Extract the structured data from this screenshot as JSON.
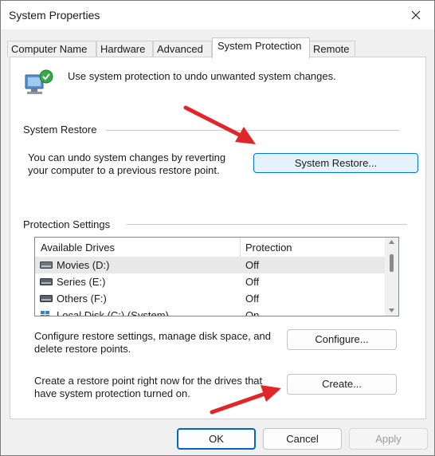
{
  "window": {
    "title": "System Properties"
  },
  "tabs": [
    "Computer Name",
    "Hardware",
    "Advanced",
    "System Protection",
    "Remote"
  ],
  "active_tab": "System Protection",
  "intro_text": "Use system protection to undo unwanted system changes.",
  "system_restore": {
    "group_label": "System Restore",
    "description_line1": "You can undo system changes by reverting",
    "description_line2": "your computer to a previous restore point.",
    "button_label": "System Restore..."
  },
  "protection": {
    "group_label": "Protection Settings",
    "columns": [
      "Available Drives",
      "Protection"
    ],
    "rows": [
      {
        "drive": "Movies (D:)",
        "protection": "Off",
        "icon": "hard-drive-icon"
      },
      {
        "drive": "Series (E:)",
        "protection": "Off",
        "icon": "hard-drive-icon"
      },
      {
        "drive": "Others (F:)",
        "protection": "Off",
        "icon": "hard-drive-icon"
      },
      {
        "drive": "Local Disk (C:) (System)",
        "protection": "On",
        "icon": "windows-drive-icon"
      }
    ],
    "configure_text_line1": "Configure restore settings, manage disk space, and",
    "configure_text_line2": "delete restore points.",
    "configure_label": "Configure...",
    "create_text_line1": "Create a restore point right now for the drives that",
    "create_text_line2": "have system protection turned on.",
    "create_label": "Create..."
  },
  "footer": {
    "ok": "OK",
    "cancel": "Cancel",
    "apply": "Apply"
  },
  "colors": {
    "accent_border": "#0078d7",
    "accent_fill": "#e5f1fb",
    "arrow": "#e0262b"
  }
}
